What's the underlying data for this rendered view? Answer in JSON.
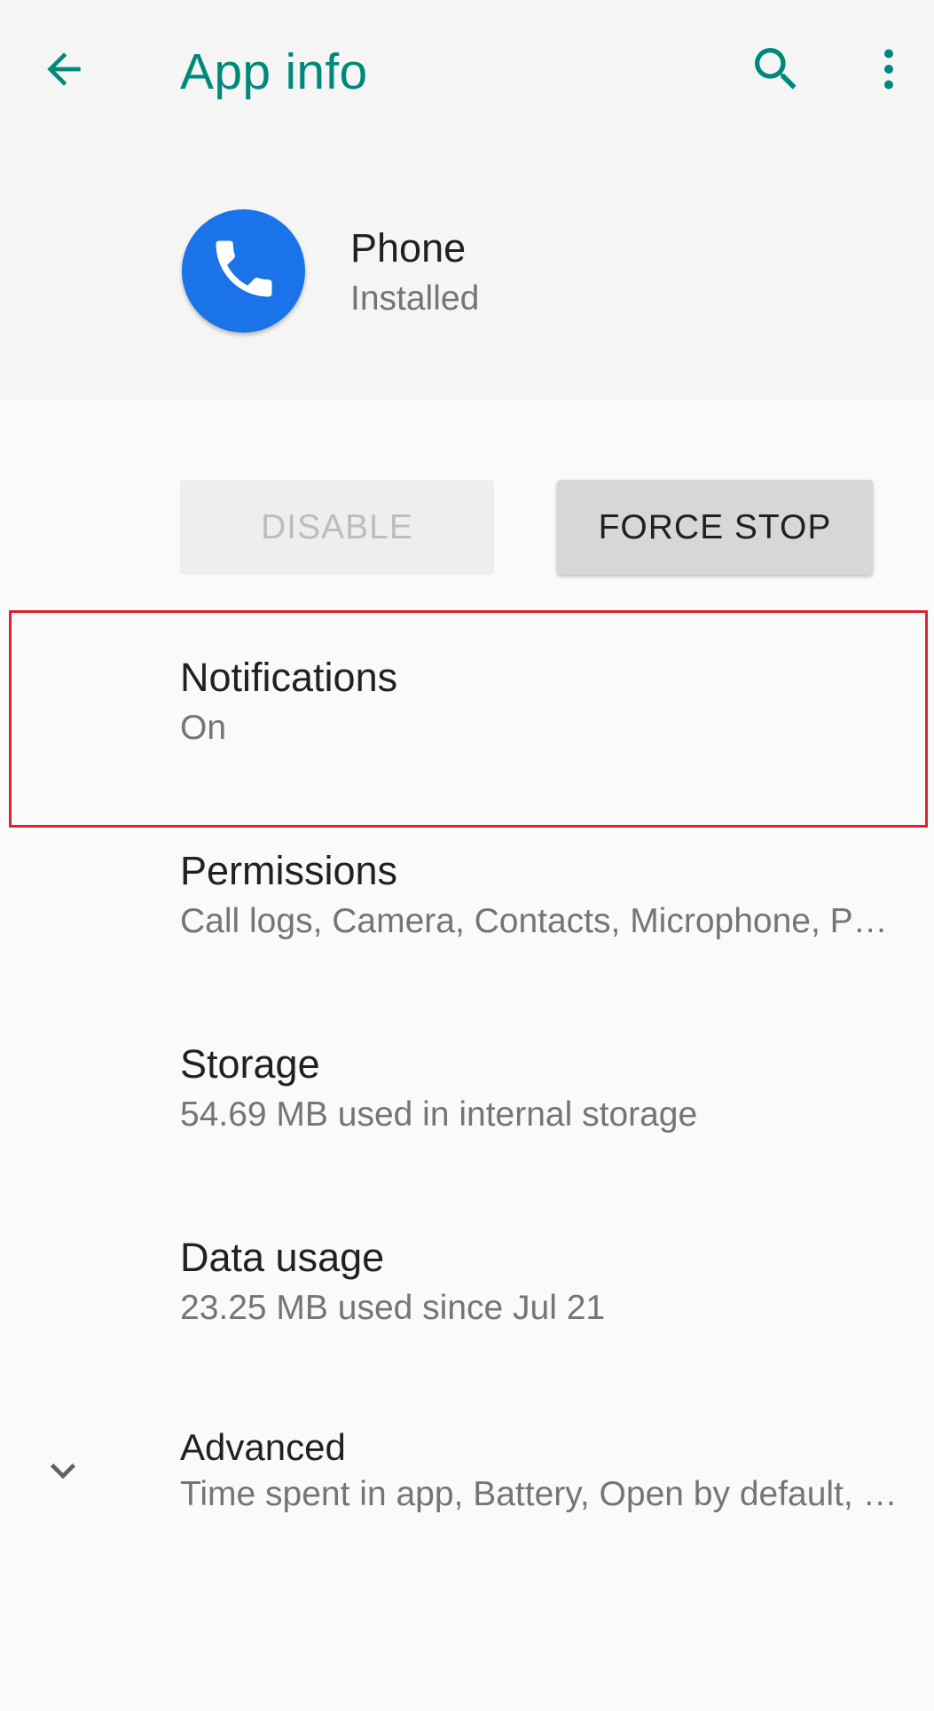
{
  "appbar": {
    "title": "App info",
    "accent_color": "#00897b",
    "icons": [
      "back-arrow-icon",
      "search-icon",
      "more-vert-icon"
    ]
  },
  "app": {
    "name": "Phone",
    "status": "Installed",
    "icon": "phone-icon",
    "icon_color": "#1a73e8"
  },
  "buttons": {
    "disable_label": "DISABLE",
    "force_stop_label": "FORCE STOP"
  },
  "prefs": {
    "notifications": {
      "title": "Notifications",
      "summary": "On"
    },
    "permissions": {
      "title": "Permissions",
      "summary": "Call logs, Camera, Contacts, Microphone, Phone, SMS, Storage"
    },
    "storage": {
      "title": "Storage",
      "summary": "54.69 MB used in internal storage"
    },
    "data_usage": {
      "title": "Data usage",
      "summary": "23.25 MB used since Jul 21"
    },
    "advanced": {
      "title": "Advanced",
      "summary": "Time spent in app, Battery, Open by default, Memory",
      "icon": "chevron-down-icon"
    }
  },
  "highlight_color": "#e0202e"
}
